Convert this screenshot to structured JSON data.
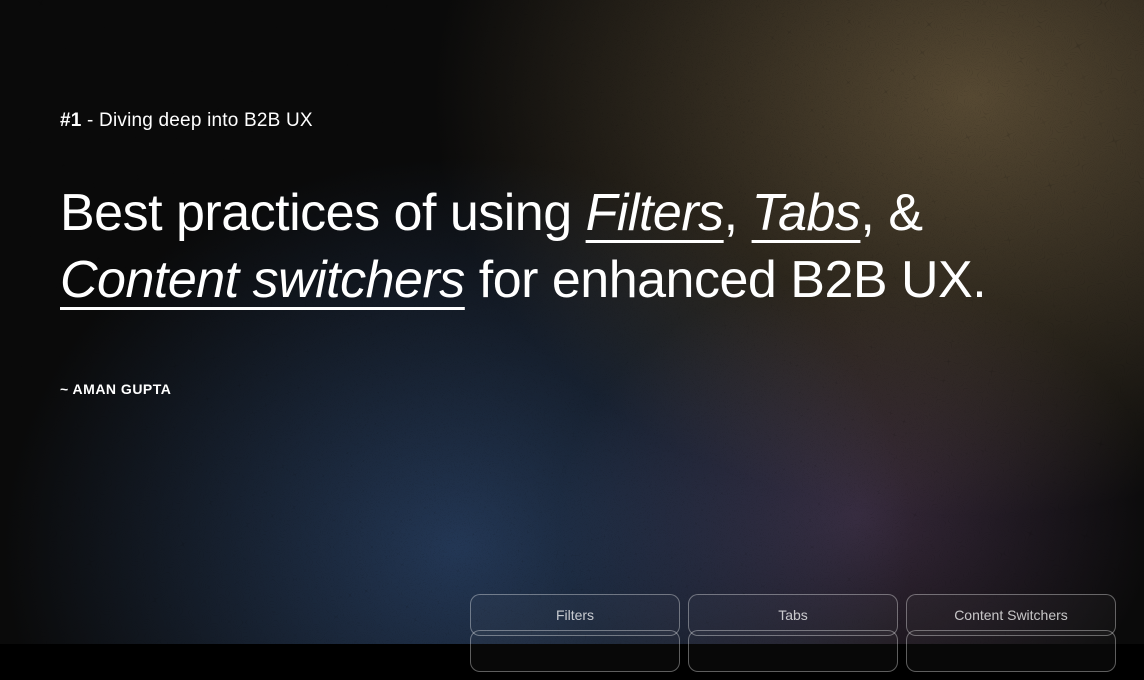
{
  "eyebrow": {
    "number": "#1",
    "separator": " - ",
    "text": "Diving deep into B2B UX"
  },
  "title": {
    "part1": "Best practices of using ",
    "emphasis1": "Filters",
    "part2": ", ",
    "emphasis2": "Tabs",
    "part3": ", & ",
    "emphasis3": "Content switchers",
    "part4": " for enhanced B2B UX."
  },
  "author": "~ AMAN GUPTA",
  "tabs": [
    {
      "label": "Filters"
    },
    {
      "label": "Tabs"
    },
    {
      "label": "Content Switchers"
    }
  ]
}
